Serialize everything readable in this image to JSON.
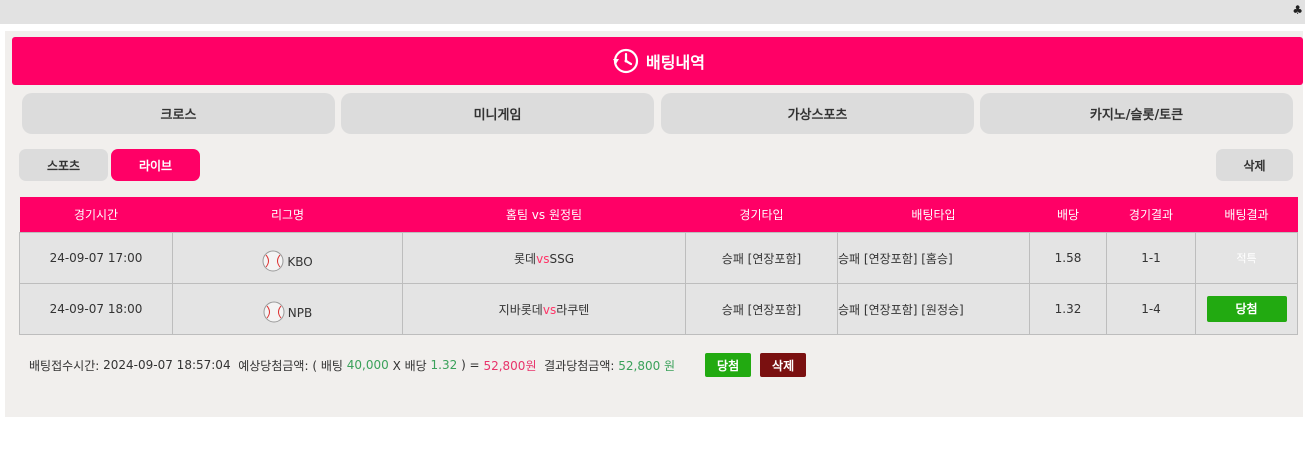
{
  "topbar": {
    "club_glyph": "♣"
  },
  "header": {
    "title": "배팅내역",
    "icon": "clock-history-icon"
  },
  "tabs": [
    {
      "label": "크로스"
    },
    {
      "label": "미니게임"
    },
    {
      "label": "가상스포츠"
    },
    {
      "label": "카지노/슬롯/토큰"
    }
  ],
  "subtabs": {
    "sports": "스포츠",
    "live": "라이브",
    "delete": "삭제"
  },
  "table": {
    "headers": [
      "경기시간",
      "리그명",
      "홈팀 vs 원정팀",
      "경기타입",
      "배팅타입",
      "배당",
      "경기결과",
      "배팅결과"
    ],
    "vs_text": "vs",
    "rows": [
      {
        "time": "24-09-07 17:00",
        "league": "KBO",
        "home": "롯데",
        "away": "SSG",
        "game_type": "승패 [연장포함]",
        "bet_type": "승패 [연장포함] [홈승]",
        "odds": "1.58",
        "score": "1-1",
        "result": "적특",
        "result_kind": "void"
      },
      {
        "time": "24-09-07 18:00",
        "league": "NPB",
        "home": "지바롯데",
        "away": "라쿠텐",
        "game_type": "승패 [연장포함]",
        "bet_type": "승패 [연장포함] [원정승]",
        "odds": "1.32",
        "score": "1-4",
        "result": "당첨",
        "result_kind": "win"
      }
    ]
  },
  "summary": {
    "time_label": "배팅접수시간:",
    "time_value": "2024-09-07 18:57:04",
    "expected_label": "예상당첨금액: ( 배팅",
    "bet_amount": "40,000",
    "x_odds_label": "X 배당",
    "odds": "1.32",
    "close_eq": ") =",
    "expected_value": "52,800원",
    "result_label": "결과당첨금액:",
    "result_value": "52,800 원",
    "win_button": "당첨",
    "delete_button": "삭제"
  },
  "colors": {
    "accent": "#ff0066",
    "win": "#22aa11",
    "delete": "#7a1010"
  }
}
